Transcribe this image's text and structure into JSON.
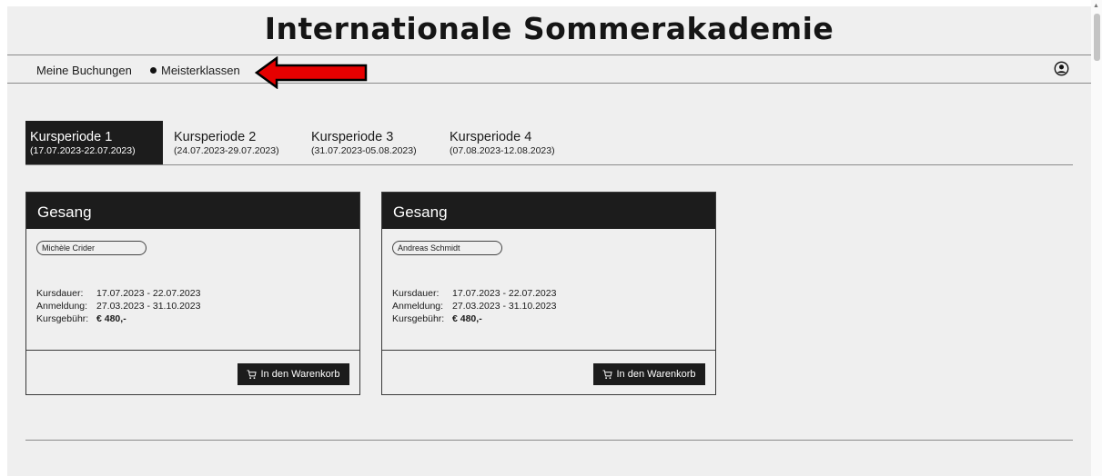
{
  "site": {
    "title": "Internationale Sommerakademie"
  },
  "nav": {
    "items": [
      "Meine Buchungen",
      "Meisterklassen"
    ],
    "account_icon": "user-circle-icon"
  },
  "tabs": [
    {
      "label": "Kursperiode 1",
      "range": "(17.07.2023-22.07.2023)"
    },
    {
      "label": "Kursperiode 2",
      "range": "(24.07.2023-29.07.2023)"
    },
    {
      "label": "Kursperiode 3",
      "range": "(31.07.2023-05.08.2023)"
    },
    {
      "label": "Kursperiode 4",
      "range": "(07.08.2023-12.08.2023)"
    }
  ],
  "labels": {
    "duration": "Kursdauer:",
    "registration": "Anmeldung:",
    "fee": "Kursgebühr:",
    "cart_button": "In den Warenkorb"
  },
  "courses": [
    {
      "title": "Gesang",
      "teacher": "Michèle Crider",
      "duration": "17.07.2023 - 22.07.2023",
      "registration": "27.03.2023 - 31.10.2023",
      "fee": "€ 480,-"
    },
    {
      "title": "Gesang",
      "teacher": "Andreas Schmidt",
      "duration": "17.07.2023 - 22.07.2023",
      "registration": "27.03.2023 - 31.10.2023",
      "fee": "€ 480,-"
    }
  ],
  "colors": {
    "annotation_arrow": "#e60000",
    "dark": "#1c1c1c",
    "background": "#efefef"
  }
}
